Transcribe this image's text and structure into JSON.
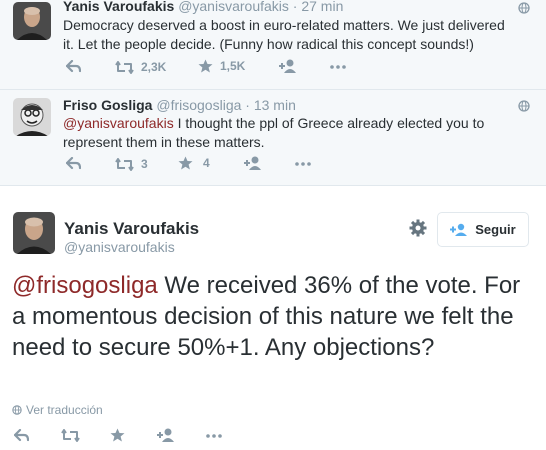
{
  "colors": {
    "accent": "#8e2929",
    "muted": "#8899a6",
    "text": "#292f33",
    "context_bg": "#f5f8fa"
  },
  "tweets": [
    {
      "name": "Yanis Varoufakis",
      "handle": "@yanisvaroufakis",
      "time": "· 27 min",
      "text": "Democracy deserved a boost in euro-related matters. We just delivered it. Let the people decide. (Funny how radical this concept sounds!)",
      "retweets": "2,3K",
      "favorites": "1,5K"
    },
    {
      "name": "Friso Gosliga",
      "handle": "@frisogosliga",
      "time": "· 13 min",
      "mention": "@yanisvaroufakis",
      "text": " I thought the ppl of Greece already elected you to represent them in these matters.",
      "retweets": "3",
      "favorites": "4"
    }
  ],
  "main": {
    "name": "Yanis Varoufakis",
    "handle": "@yanisvaroufakis",
    "follow_label": "Seguir",
    "mention": "@frisogosliga",
    "text": " We received 36% of the vote. For a momentous decision of this nature we felt the need to secure 50%+1. Any objections?",
    "translate_label": "Ver traducción"
  }
}
